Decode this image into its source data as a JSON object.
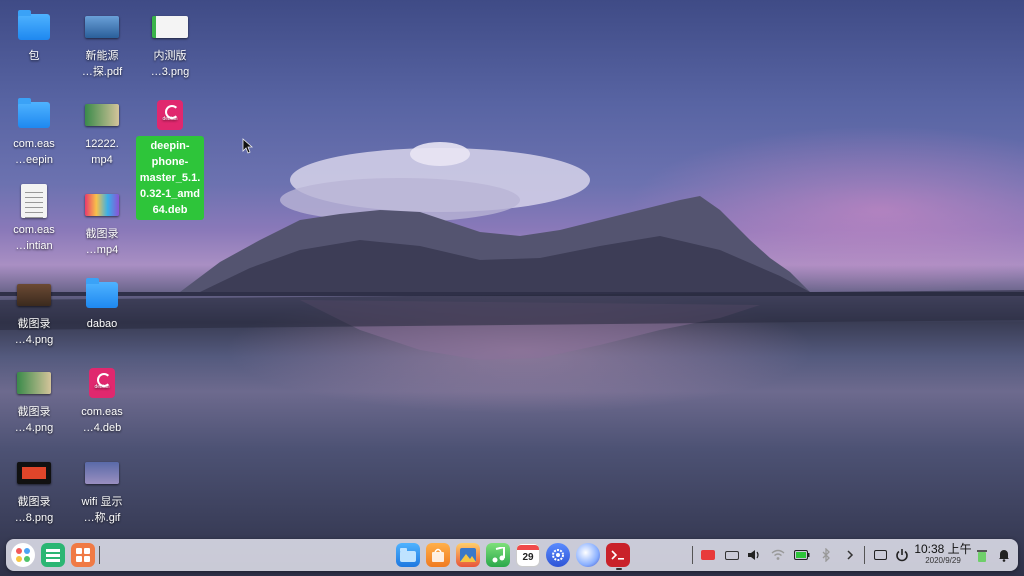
{
  "desktop": {
    "icons": [
      {
        "label": "包",
        "type": "folder"
      },
      {
        "label": "新能源\n…探.pdf",
        "type": "pdf"
      },
      {
        "label": "内测版\n…3.png",
        "type": "image"
      },
      {
        "label": "com.eas\n…eepin",
        "type": "folder"
      },
      {
        "label": "12222.\nmp4",
        "type": "video"
      },
      {
        "label": "deepin-\nphone-\nmaster_5.1.\n0.32-1_amd\n64.deb",
        "type": "deb",
        "selected": true
      },
      {
        "label": "com.eas\n…intian",
        "type": "document"
      },
      {
        "label": "截图录\n…mp4",
        "type": "video"
      },
      {
        "label": "截图录\n…4.png",
        "type": "image"
      },
      {
        "label": "dabao",
        "type": "folder"
      },
      {
        "label": "截图录\n…4.png",
        "type": "image"
      },
      {
        "label": "com.eas\n…4.deb",
        "type": "deb"
      },
      {
        "label": "截图录\n…8.png",
        "type": "image"
      },
      {
        "label": "wifi 显示\n…称.gif",
        "type": "gif"
      }
    ]
  },
  "dock": {
    "launcher_icon": "launcher-icon",
    "multitask_icon": "multitask-view-icon",
    "apps": [
      "file-manager-icon",
      "app-store-icon",
      "image-viewer-icon",
      "music-icon",
      "calendar-icon",
      "control-center-icon",
      "browser-icon",
      "terminal-icon"
    ],
    "calendar_day": "29",
    "clock_time": "10:38 上午",
    "clock_date": "2020/9/29"
  }
}
